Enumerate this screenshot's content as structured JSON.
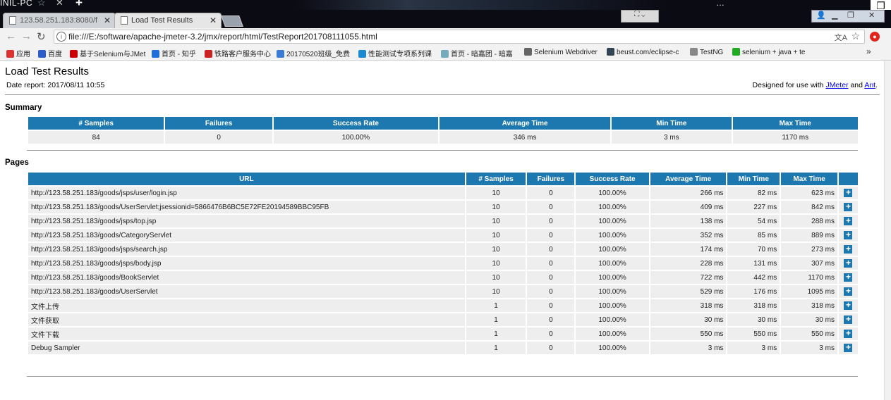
{
  "window": {
    "title_fragment": "INIL-PC",
    "right_title_fragment": "…"
  },
  "tabs": [
    {
      "label": "123.58.251.183:8080/f",
      "active": false
    },
    {
      "label": "Load Test Results",
      "active": true
    }
  ],
  "address": {
    "url": "file:///E:/software/apache-jmeter-3.2/jmx/report/html/TestReport201708111055.html"
  },
  "bookmarks": [
    {
      "label": "应用",
      "color": "#d33"
    },
    {
      "label": "百度",
      "color": "#2b5ec9"
    },
    {
      "label": "基于Selenium与JMet",
      "color": "#c00"
    },
    {
      "label": "首页 - 知乎",
      "color": "#1e6fd9"
    },
    {
      "label": "铁路客户服务中心",
      "color": "#c22"
    },
    {
      "label": "20170520班级_免费",
      "color": "#3a7bd5"
    },
    {
      "label": "性能测试专项系列课",
      "color": "#1b8ad1"
    },
    {
      "label": "首页 - 暗嘉团 - 暗嘉",
      "color": "#7ab"
    },
    {
      "label": "Selenium Webdriver",
      "color": "#666"
    },
    {
      "label": "beust.com/eclipse-c",
      "color": "#345"
    },
    {
      "label": "TestNG",
      "color": "#888"
    },
    {
      "label": "selenium + java + te",
      "color": "#2a2"
    }
  ],
  "report": {
    "title": "Load Test Results",
    "date_label": "Date report: 2017/08/11 10:55",
    "designed_prefix": "Designed for use with ",
    "designed_link1": "JMeter",
    "designed_and": " and ",
    "designed_link2": "Ant",
    "designed_suffix": "."
  },
  "summary": {
    "heading": "Summary",
    "columns": [
      "# Samples",
      "Failures",
      "Success Rate",
      "Average Time",
      "Min Time",
      "Max Time"
    ],
    "row": [
      "84",
      "0",
      "100.00%",
      "346 ms",
      "3 ms",
      "1170 ms"
    ]
  },
  "pages": {
    "heading": "Pages",
    "columns": [
      "URL",
      "# Samples",
      "Failures",
      "Success Rate",
      "Average Time",
      "Min Time",
      "Max Time",
      ""
    ],
    "rows": [
      [
        "http://123.58.251.183/goods/jsps/user/login.jsp",
        "10",
        "0",
        "100.00%",
        "266 ms",
        "82 ms",
        "623 ms"
      ],
      [
        "http://123.58.251.183/goods/UserServlet;jsessionid=5866476B6BC5E72FE20194589BBC95FB",
        "10",
        "0",
        "100.00%",
        "409 ms",
        "227 ms",
        "842 ms"
      ],
      [
        "http://123.58.251.183/goods/jsps/top.jsp",
        "10",
        "0",
        "100.00%",
        "138 ms",
        "54 ms",
        "288 ms"
      ],
      [
        "http://123.58.251.183/goods/CategoryServlet",
        "10",
        "0",
        "100.00%",
        "352 ms",
        "85 ms",
        "889 ms"
      ],
      [
        "http://123.58.251.183/goods/jsps/search.jsp",
        "10",
        "0",
        "100.00%",
        "174 ms",
        "70 ms",
        "273 ms"
      ],
      [
        "http://123.58.251.183/goods/jsps/body.jsp",
        "10",
        "0",
        "100.00%",
        "228 ms",
        "131 ms",
        "307 ms"
      ],
      [
        "http://123.58.251.183/goods/BookServlet",
        "10",
        "0",
        "100.00%",
        "722 ms",
        "442 ms",
        "1170 ms"
      ],
      [
        "http://123.58.251.183/goods/UserServlet",
        "10",
        "0",
        "100.00%",
        "529 ms",
        "176 ms",
        "1095 ms"
      ],
      [
        "文件上传",
        "1",
        "0",
        "100.00%",
        "318 ms",
        "318 ms",
        "318 ms"
      ],
      [
        "文件获取",
        "1",
        "0",
        "100.00%",
        "30 ms",
        "30 ms",
        "30 ms"
      ],
      [
        "文件下载",
        "1",
        "0",
        "100.00%",
        "550 ms",
        "550 ms",
        "550 ms"
      ],
      [
        "Debug Sampler",
        "1",
        "0",
        "100.00%",
        "3 ms",
        "3 ms",
        "3 ms"
      ]
    ],
    "expand_symbol": "+"
  },
  "colors": {
    "header_blue": "#1e78b0",
    "row_gray": "#eeeeee",
    "link_blue": "#0000ee"
  }
}
